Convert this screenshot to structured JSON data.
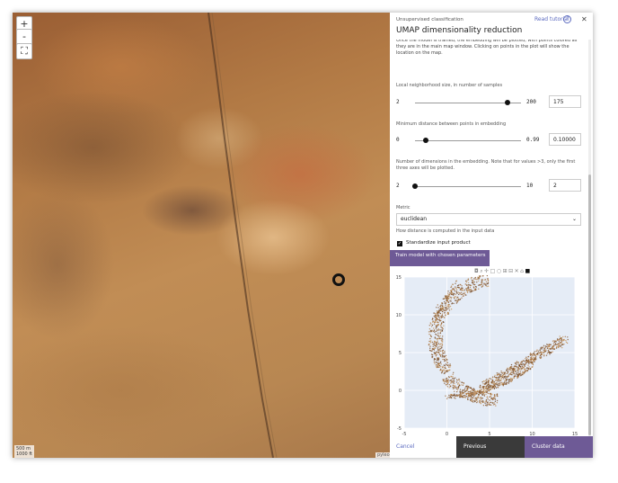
{
  "map": {
    "zoom_in_label": "+",
    "zoom_out_label": "-",
    "fullscreen_label": "⛶",
    "scale_m": "500 m",
    "scale_ft": "1000 ft",
    "attribution": "pyleo"
  },
  "panel": {
    "breadcrumb": "Unsupervised classification",
    "tutorial_label": "Read tutorial",
    "help_label": "?",
    "close_label": "✕",
    "title": "UMAP dimensionality reduction",
    "intro": "Once the model is trained, the embedding will be plotted, with points colored as they are in the main map window. Clicking on points in the plot will show the location on the map.",
    "params": {
      "neighbors": {
        "label": "Local neighborhood size, in number of samples",
        "min": "2",
        "max": "200",
        "value": "175",
        "fraction": 0.87
      },
      "min_dist": {
        "label": "Minimum distance between points in embedding",
        "min": "0",
        "max": "0.99",
        "value": "0.10000",
        "fraction": 0.1
      },
      "n_components": {
        "label": "Number of dimensions in the embedding. Note that for values >3, only the first three axes will be plotted.",
        "min": "2",
        "max": "10",
        "value": "2",
        "fraction": 0.0
      }
    },
    "metric": {
      "label": "Metric",
      "selected": "euclidean",
      "help": "How distance is computed in the input data"
    },
    "standardize": {
      "label": "Standardize input product",
      "checked": true
    },
    "train_button": "Train model with chosen parameters",
    "modebar_icons": [
      "camera-icon",
      "zoom-icon",
      "pan-icon",
      "box-select-icon",
      "lasso-icon",
      "zoom-in-icon",
      "zoom-out-icon",
      "autoscale-icon",
      "reset-icon",
      "plotly-logo-icon"
    ],
    "footer": {
      "cancel": "Cancel",
      "previous": "Previous",
      "next": "Cluster data"
    }
  },
  "chart_data": {
    "type": "scatter",
    "title": "",
    "xlabel": "",
    "ylabel": "",
    "xlim": [
      -5,
      15
    ],
    "ylim": [
      -5,
      15
    ],
    "xticks": [
      -5,
      0,
      5,
      10,
      15
    ],
    "yticks": [
      -5,
      0,
      5,
      10,
      15
    ],
    "grid": true,
    "colors": {
      "points": "#9a6a3c",
      "background": "#e5ecf6"
    }
  }
}
